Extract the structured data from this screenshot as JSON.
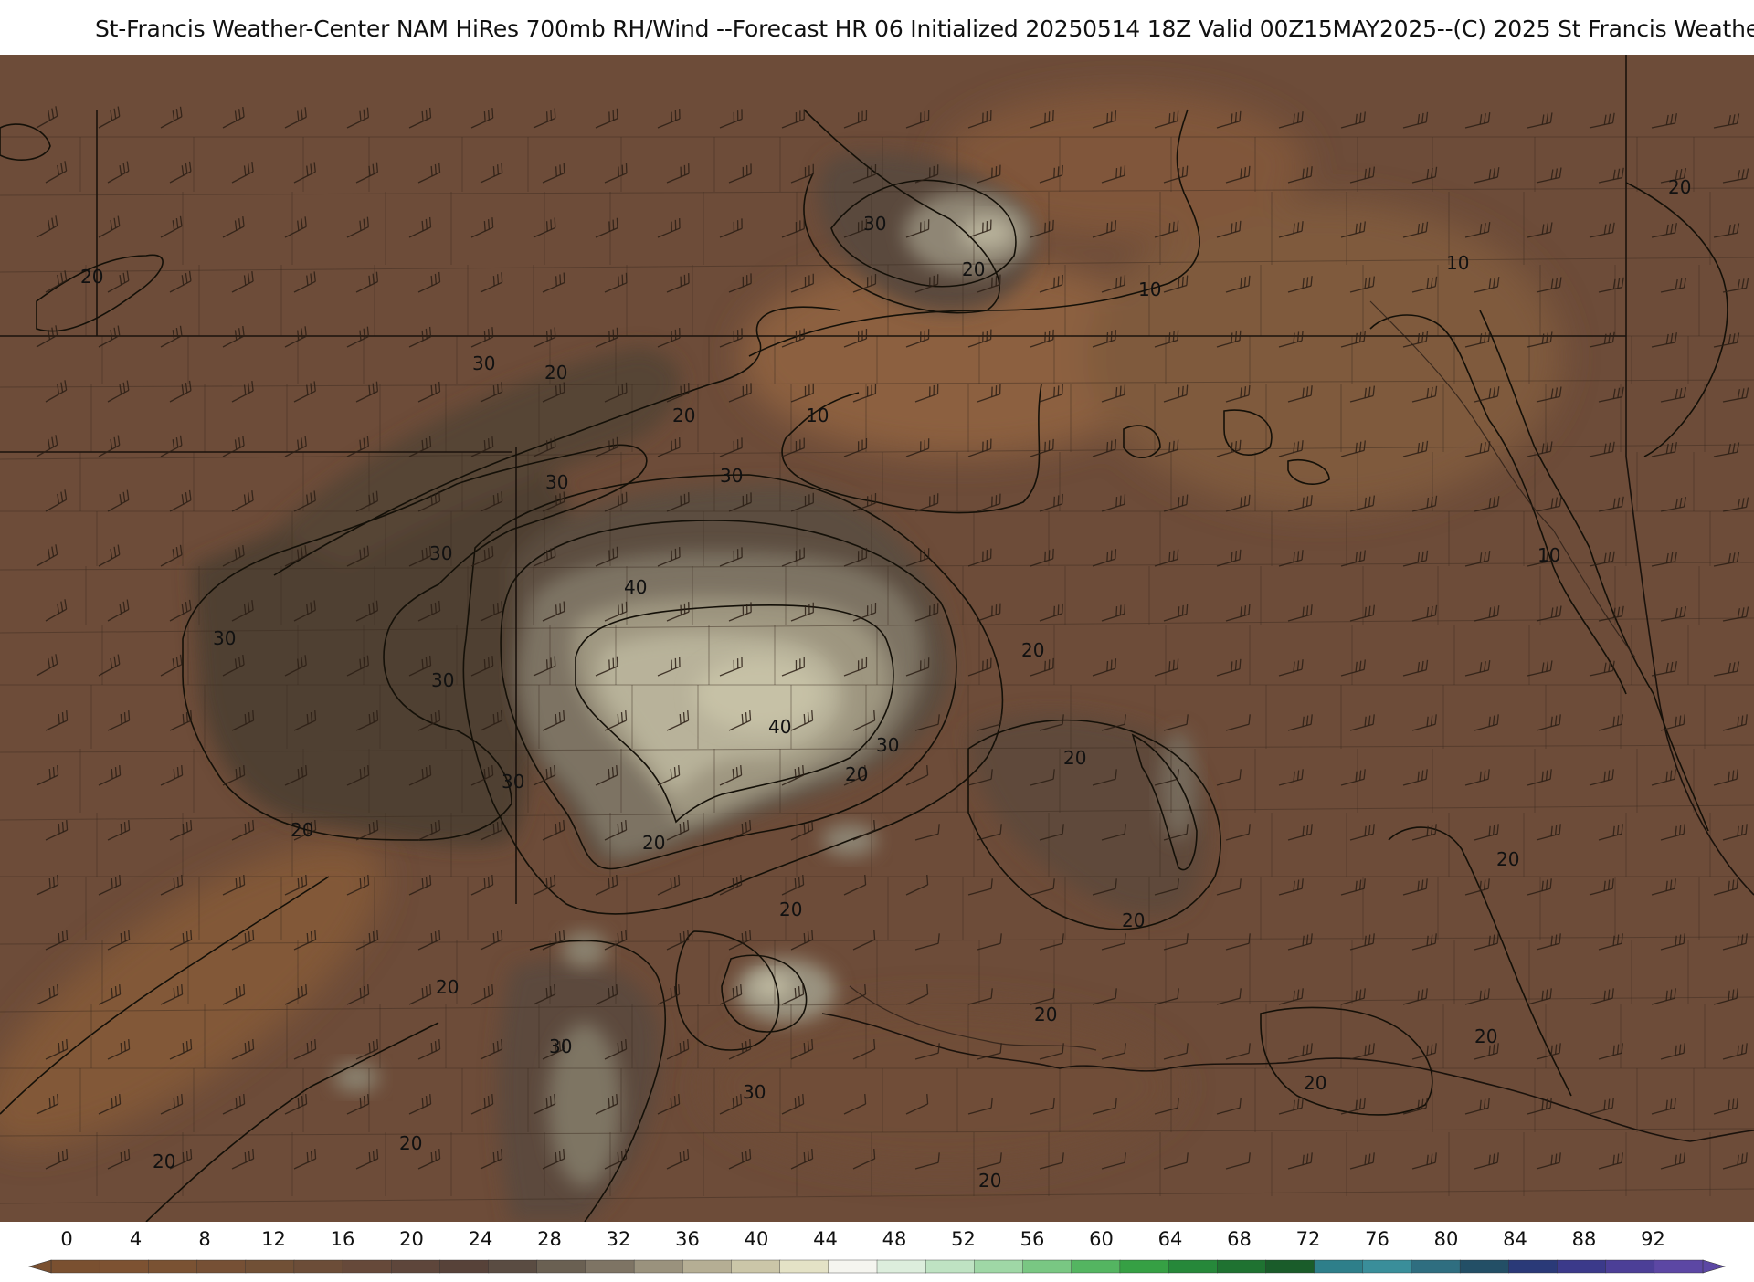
{
  "title": "St-Francis Weather-Center NAM HiRes 700mb RH/Wind  --Forecast HR 06 Initialized 20250514 18Z Valid 00Z15MAY2025--(C) 2025 St Francis Weather C",
  "map": {
    "field": "700mb relative humidity",
    "overlay": "wind barbs",
    "contour_labels": [
      {
        "id": "c1",
        "text": "20"
      },
      {
        "id": "c2",
        "text": "30"
      },
      {
        "id": "c3",
        "text": "20"
      },
      {
        "id": "c4",
        "text": "10"
      },
      {
        "id": "c5",
        "text": "10"
      },
      {
        "id": "c6",
        "text": "20"
      },
      {
        "id": "c7",
        "text": "30"
      },
      {
        "id": "c8",
        "text": "20"
      },
      {
        "id": "c9",
        "text": "20"
      },
      {
        "id": "c10",
        "text": "10"
      },
      {
        "id": "c11",
        "text": "30"
      },
      {
        "id": "c12",
        "text": "30"
      },
      {
        "id": "c13",
        "text": "30"
      },
      {
        "id": "c14",
        "text": "40"
      },
      {
        "id": "c15",
        "text": "30"
      },
      {
        "id": "c16",
        "text": "30"
      },
      {
        "id": "c17",
        "text": "40"
      },
      {
        "id": "c18",
        "text": "30"
      },
      {
        "id": "c19",
        "text": "20"
      },
      {
        "id": "c20",
        "text": "20"
      },
      {
        "id": "c21",
        "text": "10"
      },
      {
        "id": "c22",
        "text": "20"
      },
      {
        "id": "c23",
        "text": "30"
      },
      {
        "id": "c24",
        "text": "20"
      },
      {
        "id": "c25",
        "text": "20"
      },
      {
        "id": "c26",
        "text": "20"
      },
      {
        "id": "c27",
        "text": "20"
      },
      {
        "id": "c28",
        "text": "20"
      },
      {
        "id": "c29",
        "text": "30"
      },
      {
        "id": "c30",
        "text": "30"
      },
      {
        "id": "c31",
        "text": "20"
      },
      {
        "id": "c32",
        "text": "20"
      },
      {
        "id": "c33",
        "text": "20"
      },
      {
        "id": "c34",
        "text": "20"
      },
      {
        "id": "c35",
        "text": "20"
      },
      {
        "id": "c36",
        "text": "20"
      },
      {
        "id": "c37",
        "text": "20"
      }
    ]
  },
  "colorbar": {
    "ticks": [
      "0",
      "4",
      "8",
      "12",
      "16",
      "20",
      "24",
      "28",
      "32",
      "36",
      "40",
      "44",
      "48",
      "52",
      "56",
      "60",
      "64",
      "68",
      "72",
      "76",
      "80",
      "84",
      "88",
      "92"
    ],
    "colors": [
      "#7a5030",
      "#7d5232",
      "#7a5233",
      "#765035",
      "#715036",
      "#6c4d38",
      "#66493a",
      "#5e463b",
      "#574239",
      "#5a4c42",
      "#6a6052",
      "#7e7464",
      "#9a927d",
      "#b5ae94",
      "#cbc6a8",
      "#e4e2c6",
      "#f5f5ef",
      "#ddeedd",
      "#bfe3c3",
      "#9fd7a6",
      "#79c783",
      "#54b561",
      "#36a044",
      "#26883a",
      "#1f7231",
      "#1a5c2a",
      "#2e7f8a",
      "#3a8e9a",
      "#2f6e80",
      "#234f66",
      "#2a3a78",
      "#3b3a8a",
      "#4c3f97",
      "#5c47a4"
    ]
  }
}
